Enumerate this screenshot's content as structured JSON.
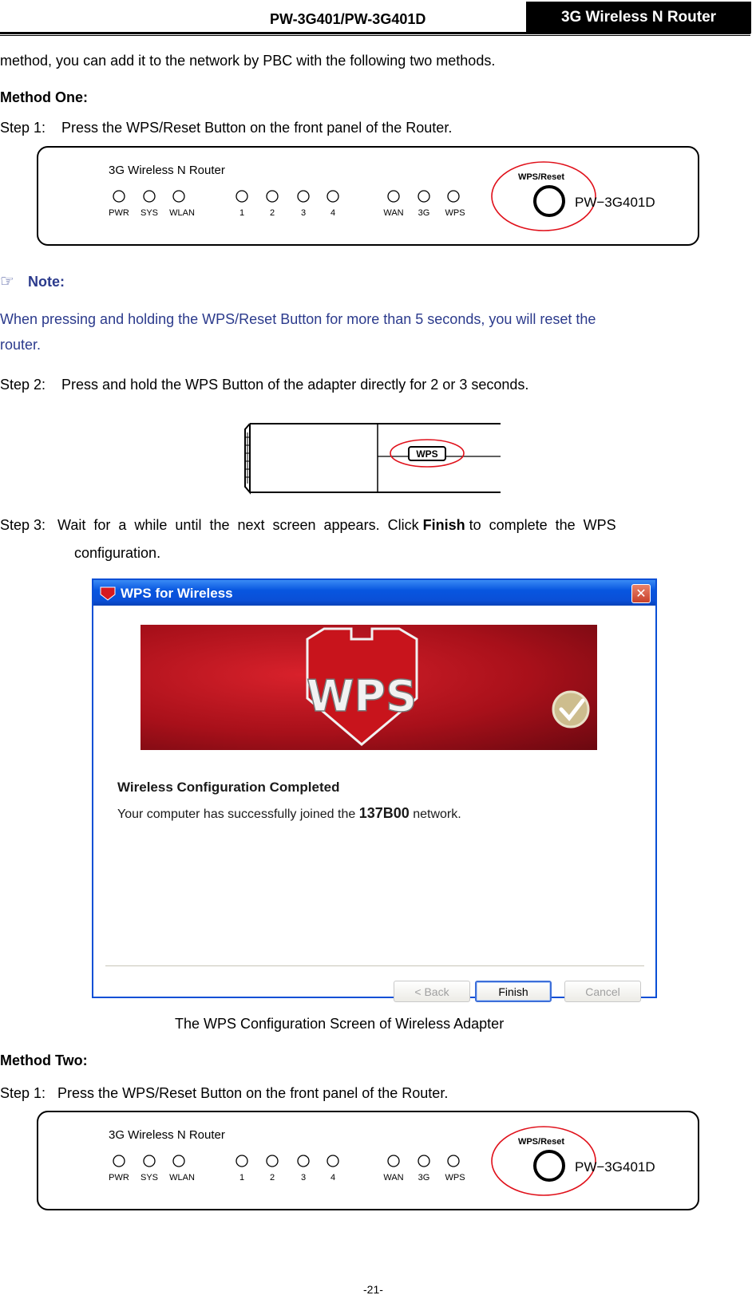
{
  "header": {
    "model": "PW-3G401/PW-3G401D",
    "product": "3G Wireless N Router"
  },
  "intro": "method, you can add it to the network by PBC with the following two methods.",
  "method_one": {
    "heading": "Method One:",
    "step1": "Step 1:    Press the WPS/Reset Button on the front panel of the Router.",
    "note_label": "Note:",
    "note_line1": "When pressing and holding the WPS/Reset Button for more than 5 seconds, you will reset the",
    "note_line2": "router.",
    "step2": "Step 2:    Press and hold the WPS Button of the adapter directly for 2 or 3 seconds.",
    "step3_prefix": "Step 3:   Wait  for  a  while  until  the  next  screen  appears.  Click ",
    "step3_bold": "Finish",
    "step3_suffix": " to  complete  the  WPS",
    "step3_line2": "configuration."
  },
  "router_panel": {
    "title": "3G Wireless N Router",
    "led_labels": [
      "PWR",
      "SYS",
      "WLAN"
    ],
    "port_labels": [
      "1",
      "2",
      "3",
      "4"
    ],
    "wan_labels": [
      "WAN",
      "3G",
      "WPS"
    ],
    "button_label": "WPS/Reset",
    "model": "PW−3G401D"
  },
  "adapter": {
    "button_label": "WPS"
  },
  "wps_dialog": {
    "title": "WPS for Wireless",
    "logo_text": "WPS",
    "heading": "Wireless Configuration Completed",
    "message_prefix": "Your computer has successfully joined the ",
    "network_name": "137B00",
    "message_suffix": " network.",
    "back_label": "< Back",
    "finish_label": "Finish",
    "cancel_label": "Cancel"
  },
  "caption": "The WPS Configuration Screen of Wireless Adapter",
  "method_two": {
    "heading": "Method Two:",
    "step1": "Step 1:   Press the WPS/Reset Button on the front panel of the Router."
  },
  "page_number": "-21-",
  "colors": {
    "note": "#2b3a8c",
    "highlight_ring": "#e0101a",
    "dialog_title": "#0a4fd6"
  }
}
